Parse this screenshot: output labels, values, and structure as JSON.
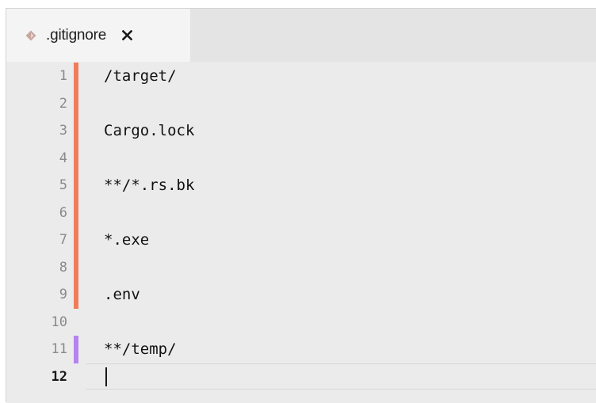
{
  "tab": {
    "icon": "gitignore-file-icon",
    "label": ".gitignore",
    "close_symbol": "×",
    "close_icon": "close-icon"
  },
  "colors": {
    "modified_marker": "#ef7d5a",
    "added_marker": "#b583f0",
    "file_icon": "#c9a8a0"
  },
  "editor": {
    "active_line": 12,
    "lines": [
      {
        "number": "1",
        "text": "/target/",
        "marker": "modified"
      },
      {
        "number": "2",
        "text": "",
        "marker": "modified"
      },
      {
        "number": "3",
        "text": "Cargo.lock",
        "marker": "modified"
      },
      {
        "number": "4",
        "text": "",
        "marker": "modified"
      },
      {
        "number": "5",
        "text": "**/*.rs.bk",
        "marker": "modified"
      },
      {
        "number": "6",
        "text": "",
        "marker": "modified"
      },
      {
        "number": "7",
        "text": "*.exe",
        "marker": "modified"
      },
      {
        "number": "8",
        "text": "",
        "marker": "modified"
      },
      {
        "number": "9",
        "text": ".env",
        "marker": "modified"
      },
      {
        "number": "10",
        "text": "",
        "marker": "none"
      },
      {
        "number": "11",
        "text": "**/temp/",
        "marker": "added"
      },
      {
        "number": "12",
        "text": "",
        "marker": "none"
      }
    ]
  }
}
